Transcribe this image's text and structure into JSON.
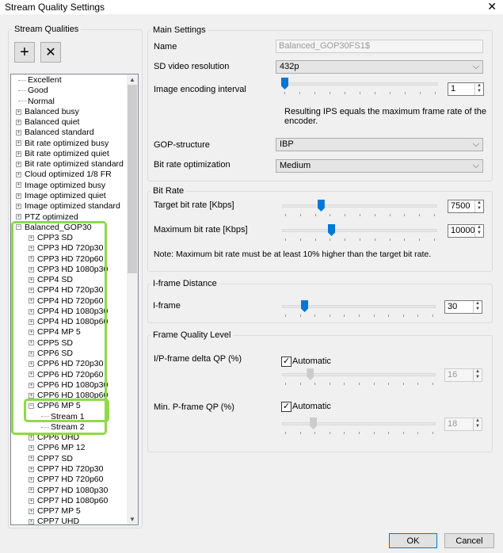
{
  "window": {
    "title": "Stream Quality Settings",
    "close": "✕"
  },
  "left": {
    "group_label": "Stream Qualities",
    "add_icon": "+",
    "remove_icon": "✕",
    "tree": [
      {
        "t": "Excellent",
        "l": 0,
        "k": "leaf"
      },
      {
        "t": "Good",
        "l": 0,
        "k": "leaf"
      },
      {
        "t": "Normal",
        "l": 0,
        "k": "leaf"
      },
      {
        "t": "Balanced busy",
        "l": 0,
        "k": "plus"
      },
      {
        "t": "Balanced quiet",
        "l": 0,
        "k": "plus"
      },
      {
        "t": "Balanced standard",
        "l": 0,
        "k": "plus"
      },
      {
        "t": "Bit rate optimized busy",
        "l": 0,
        "k": "plus"
      },
      {
        "t": "Bit rate optimized quiet",
        "l": 0,
        "k": "plus"
      },
      {
        "t": "Bit rate optimized standard",
        "l": 0,
        "k": "plus"
      },
      {
        "t": "Cloud optimized 1/8 FR",
        "l": 0,
        "k": "plus"
      },
      {
        "t": "Image optimized busy",
        "l": 0,
        "k": "plus"
      },
      {
        "t": "Image optimized quiet",
        "l": 0,
        "k": "plus"
      },
      {
        "t": "Image optimized standard",
        "l": 0,
        "k": "plus"
      },
      {
        "t": "PTZ optimized",
        "l": 0,
        "k": "plus"
      },
      {
        "t": "Balanced_GOP30",
        "l": 0,
        "k": "minus"
      },
      {
        "t": "CPP3 SD",
        "l": 1,
        "k": "plus"
      },
      {
        "t": "CPP3 HD 720p30",
        "l": 1,
        "k": "plus"
      },
      {
        "t": "CPP3 HD 720p60",
        "l": 1,
        "k": "plus"
      },
      {
        "t": "CPP3 HD 1080p30",
        "l": 1,
        "k": "plus"
      },
      {
        "t": "CPP4 SD",
        "l": 1,
        "k": "plus"
      },
      {
        "t": "CPP4 HD 720p30",
        "l": 1,
        "k": "plus"
      },
      {
        "t": "CPP4 HD 720p60",
        "l": 1,
        "k": "plus"
      },
      {
        "t": "CPP4 HD 1080p30",
        "l": 1,
        "k": "plus"
      },
      {
        "t": "CPP4 HD 1080p60",
        "l": 1,
        "k": "plus"
      },
      {
        "t": "CPP4 MP 5",
        "l": 1,
        "k": "plus"
      },
      {
        "t": "CPP5 SD",
        "l": 1,
        "k": "plus"
      },
      {
        "t": "CPP6 SD",
        "l": 1,
        "k": "plus"
      },
      {
        "t": "CPP6 HD 720p30",
        "l": 1,
        "k": "plus"
      },
      {
        "t": "CPP6 HD 720p60",
        "l": 1,
        "k": "plus"
      },
      {
        "t": "CPP6 HD 1080p30",
        "l": 1,
        "k": "plus"
      },
      {
        "t": "CPP6 HD 1080p60",
        "l": 1,
        "k": "plus"
      },
      {
        "t": "CPP6 MP 5",
        "l": 1,
        "k": "minus"
      },
      {
        "t": "Stream 1",
        "l": 2,
        "k": "leaf"
      },
      {
        "t": "Stream 2",
        "l": 2,
        "k": "leaf"
      },
      {
        "t": "CPP6 UHD",
        "l": 1,
        "k": "plus"
      },
      {
        "t": "CPP6 MP 12",
        "l": 1,
        "k": "plus"
      },
      {
        "t": "CPP7 SD",
        "l": 1,
        "k": "plus"
      },
      {
        "t": "CPP7 HD 720p30",
        "l": 1,
        "k": "plus"
      },
      {
        "t": "CPP7 HD 720p60",
        "l": 1,
        "k": "plus"
      },
      {
        "t": "CPP7 HD 1080p30",
        "l": 1,
        "k": "plus"
      },
      {
        "t": "CPP7 HD 1080p60",
        "l": 1,
        "k": "plus"
      },
      {
        "t": "CPP7 MP 5",
        "l": 1,
        "k": "plus"
      },
      {
        "t": "CPP7 UHD",
        "l": 1,
        "k": "plus"
      }
    ]
  },
  "main": {
    "group_label": "Main Settings",
    "name_label": "Name",
    "name_value": "Balanced_GOP30FS1$",
    "sd_label": "SD video resolution",
    "sd_value": "432p",
    "iei_label": "Image encoding interval",
    "iei_value": "1",
    "iei_fraction": 0,
    "ips_note": "Resulting IPS equals the maximum frame rate of the encoder.",
    "gop_label": "GOP-structure",
    "gop_value": "IBP",
    "bro_label": "Bit rate optimization",
    "bro_value": "Medium"
  },
  "bitrate": {
    "group_label": "Bit Rate",
    "target_label": "Target bit rate [Kbps]",
    "target_value": "7500",
    "target_fraction": 0.24,
    "max_label": "Maximum bit rate [Kbps]",
    "max_value": "10000",
    "max_fraction": 0.31,
    "note": "Note: Maximum bit rate must be at least 10% higher than the target bit rate."
  },
  "iframe": {
    "group_label": "I-frame Distance",
    "label": "I-frame",
    "value": "30",
    "fraction": 0.13
  },
  "fql": {
    "group_label": "Frame Quality Level",
    "delta_label": "I/P-frame delta QP (%)",
    "auto_label": "Automatic",
    "delta_value": "16",
    "delta_fraction": 0.17,
    "minp_label": "Min. P-frame QP (%)",
    "minp_value": "18",
    "minp_fraction": 0.19
  },
  "footer": {
    "ok": "OK",
    "cancel": "Cancel"
  },
  "colors": {
    "accent": "#0078d7",
    "highlight": "#8fd94a"
  }
}
